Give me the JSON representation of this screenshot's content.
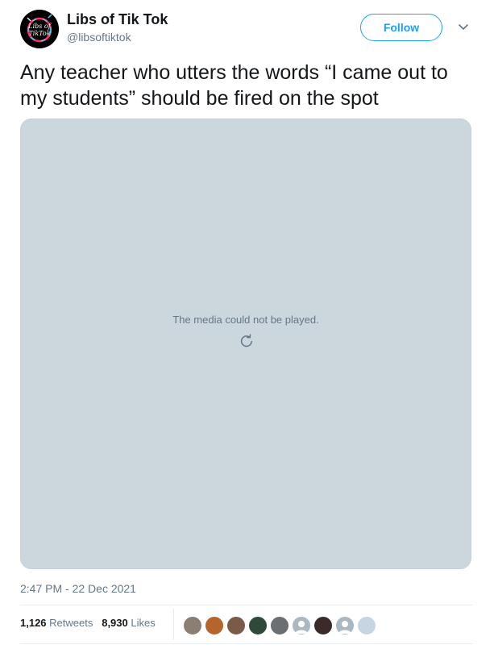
{
  "author": {
    "display_name": "Libs of Tik Tok",
    "handle": "@libsoftiktok",
    "avatar_text_line1": "Libs of",
    "avatar_text_line2": "TikTok"
  },
  "follow_label": "Follow",
  "tweet_text": "Any teacher who utters the words “I came out to my students” should be fired on the spot",
  "media": {
    "error_text": "The media could not be played."
  },
  "timestamp": "2:47 PM - 22 Dec 2021",
  "stats": {
    "retweets_count": "1,126",
    "retweets_label": "Retweets",
    "likes_count": "8,930",
    "likes_label": "Likes"
  },
  "likers": [
    {
      "icon": "liker-avatar-1",
      "color": "#8a7f72"
    },
    {
      "icon": "liker-avatar-2",
      "color": "#b5642c"
    },
    {
      "icon": "liker-avatar-3",
      "color": "#7a5b4a"
    },
    {
      "icon": "liker-avatar-4",
      "color": "#2f4a3a"
    },
    {
      "icon": "liker-avatar-5",
      "color": "#6b6f73"
    },
    {
      "icon": "liker-avatar-default",
      "color": "#aab8c2"
    },
    {
      "icon": "liker-avatar-7",
      "color": "#3a2a2a"
    },
    {
      "icon": "liker-avatar-default",
      "color": "#aab8c2"
    },
    {
      "icon": "liker-avatar-9",
      "color": "#c7d5e2"
    }
  ]
}
